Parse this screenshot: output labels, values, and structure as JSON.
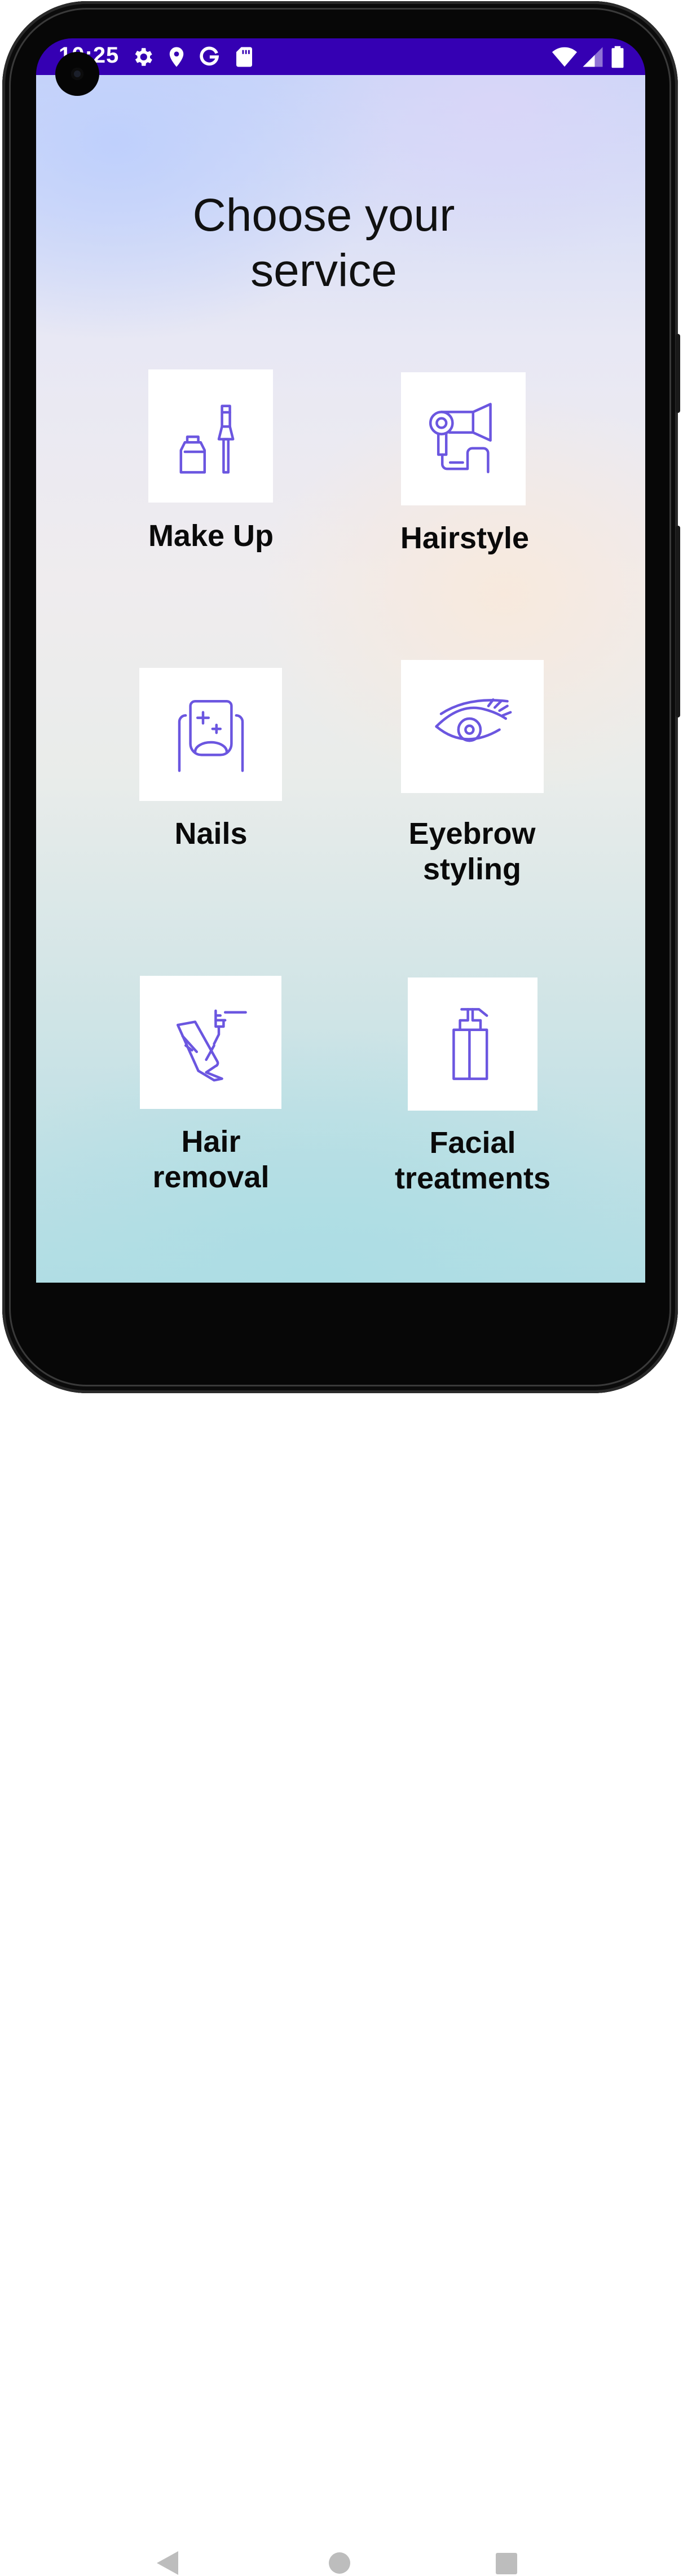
{
  "status_bar": {
    "time": "10:25",
    "left_icons": [
      "gear-icon",
      "location-pin-icon",
      "google-icon",
      "sd-card-icon"
    ],
    "right_icons": [
      "wifi-icon",
      "cell-signal-icon",
      "battery-icon"
    ]
  },
  "page": {
    "title": "Choose your\nservice"
  },
  "services": [
    {
      "label": "Make Up",
      "icon": "nail-polish-icon"
    },
    {
      "label": "Hairstyle",
      "icon": "hair-dryer-icon"
    },
    {
      "label": "Nails",
      "icon": "nail-icon"
    },
    {
      "label": "Eyebrow\nstyling",
      "icon": "eye-icon"
    },
    {
      "label": "Hair\nremoval",
      "icon": "laser-hair-removal-icon"
    },
    {
      "label": "Facial\ntreatments",
      "icon": "pump-bottle-icon"
    }
  ],
  "nav_bar": {
    "buttons": [
      "back-icon",
      "home-icon",
      "recents-icon"
    ]
  },
  "colors": {
    "status_bar": "#3500b3",
    "icon_accent": "#6b56e0",
    "text": "#0a0a0a"
  }
}
